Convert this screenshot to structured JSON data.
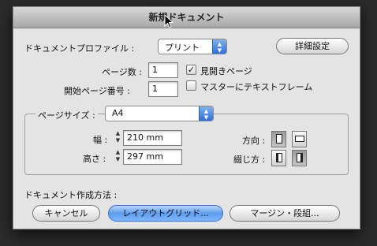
{
  "window": {
    "title": "新規ドキュメント"
  },
  "profile": {
    "label": "ドキュメントプロファイル :",
    "value": "プリント"
  },
  "details_button": "詳細設定",
  "pages": {
    "count_label": "ページ数 :",
    "count_value": "1",
    "start_label": "開始ページ番号 :",
    "start_value": "1",
    "facing_pages_label": "見開きページ",
    "facing_pages_checked": true,
    "master_text_frame_label": "マスターにテキストフレーム",
    "master_text_frame_checked": false
  },
  "page_size": {
    "label": "ページサイズ :",
    "value": "A4",
    "width_label": "幅 :",
    "width_value": "210 mm",
    "height_label": "高さ :",
    "height_value": "297 mm",
    "orientation_label": "方向 :",
    "binding_label": "綴じ方 :"
  },
  "creation": {
    "label": "ドキュメント作成方法 :",
    "cancel": "キャンセル",
    "layout_grid": "レイアウトグリッド...",
    "margins_columns": "マージン・段組..."
  },
  "icons": {
    "popup_arrows": "▲▼",
    "stepper": "▲▼",
    "checkmark": "✓"
  },
  "colors": {
    "accent_blue": "#3f84e5",
    "dialog_bg": "#e4e4e4"
  }
}
